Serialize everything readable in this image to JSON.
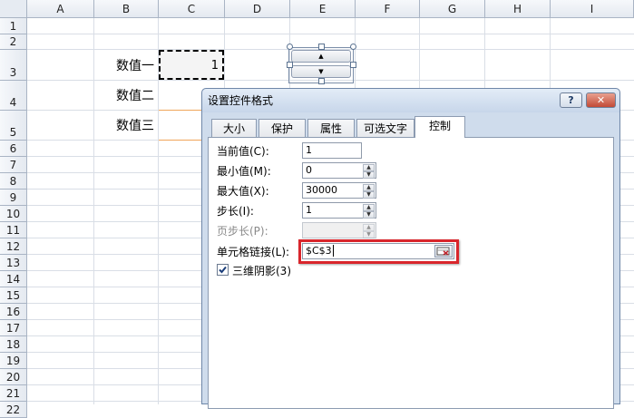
{
  "columns": [
    "A",
    "B",
    "C",
    "D",
    "E",
    "F",
    "G",
    "H",
    "I"
  ],
  "rows": [
    "1",
    "2",
    "3",
    "4",
    "5",
    "6",
    "7",
    "8",
    "9",
    "10",
    "11",
    "12",
    "13",
    "14",
    "15",
    "16",
    "17",
    "18",
    "19",
    "20",
    "21",
    "22"
  ],
  "cells": {
    "b3": "数值一",
    "c3": "1",
    "b4": "数值二",
    "b5": "数值三"
  },
  "spinner_icons": {
    "up": "▲",
    "down": "▼"
  },
  "dialog": {
    "title": "设置控件格式",
    "help": "?",
    "close": "✕",
    "tabs": [
      "大小",
      "保护",
      "属性",
      "可选文字",
      "控制"
    ],
    "fields": {
      "current": {
        "label": "当前值(C):",
        "value": "1"
      },
      "min": {
        "label": "最小值(M):",
        "value": "0"
      },
      "max": {
        "label": "最大值(X):",
        "value": "30000"
      },
      "step": {
        "label": "步长(I):",
        "value": "1"
      },
      "page": {
        "label": "页步长(P):",
        "value": ""
      },
      "link": {
        "label": "单元格链接(L):",
        "value": "$C$3"
      }
    },
    "checkbox": {
      "label": "三维阴影(3)",
      "checked": true
    }
  },
  "colors": {
    "highlight": "#d9262c",
    "selection": "#000000",
    "accent": "#f0a55a"
  }
}
